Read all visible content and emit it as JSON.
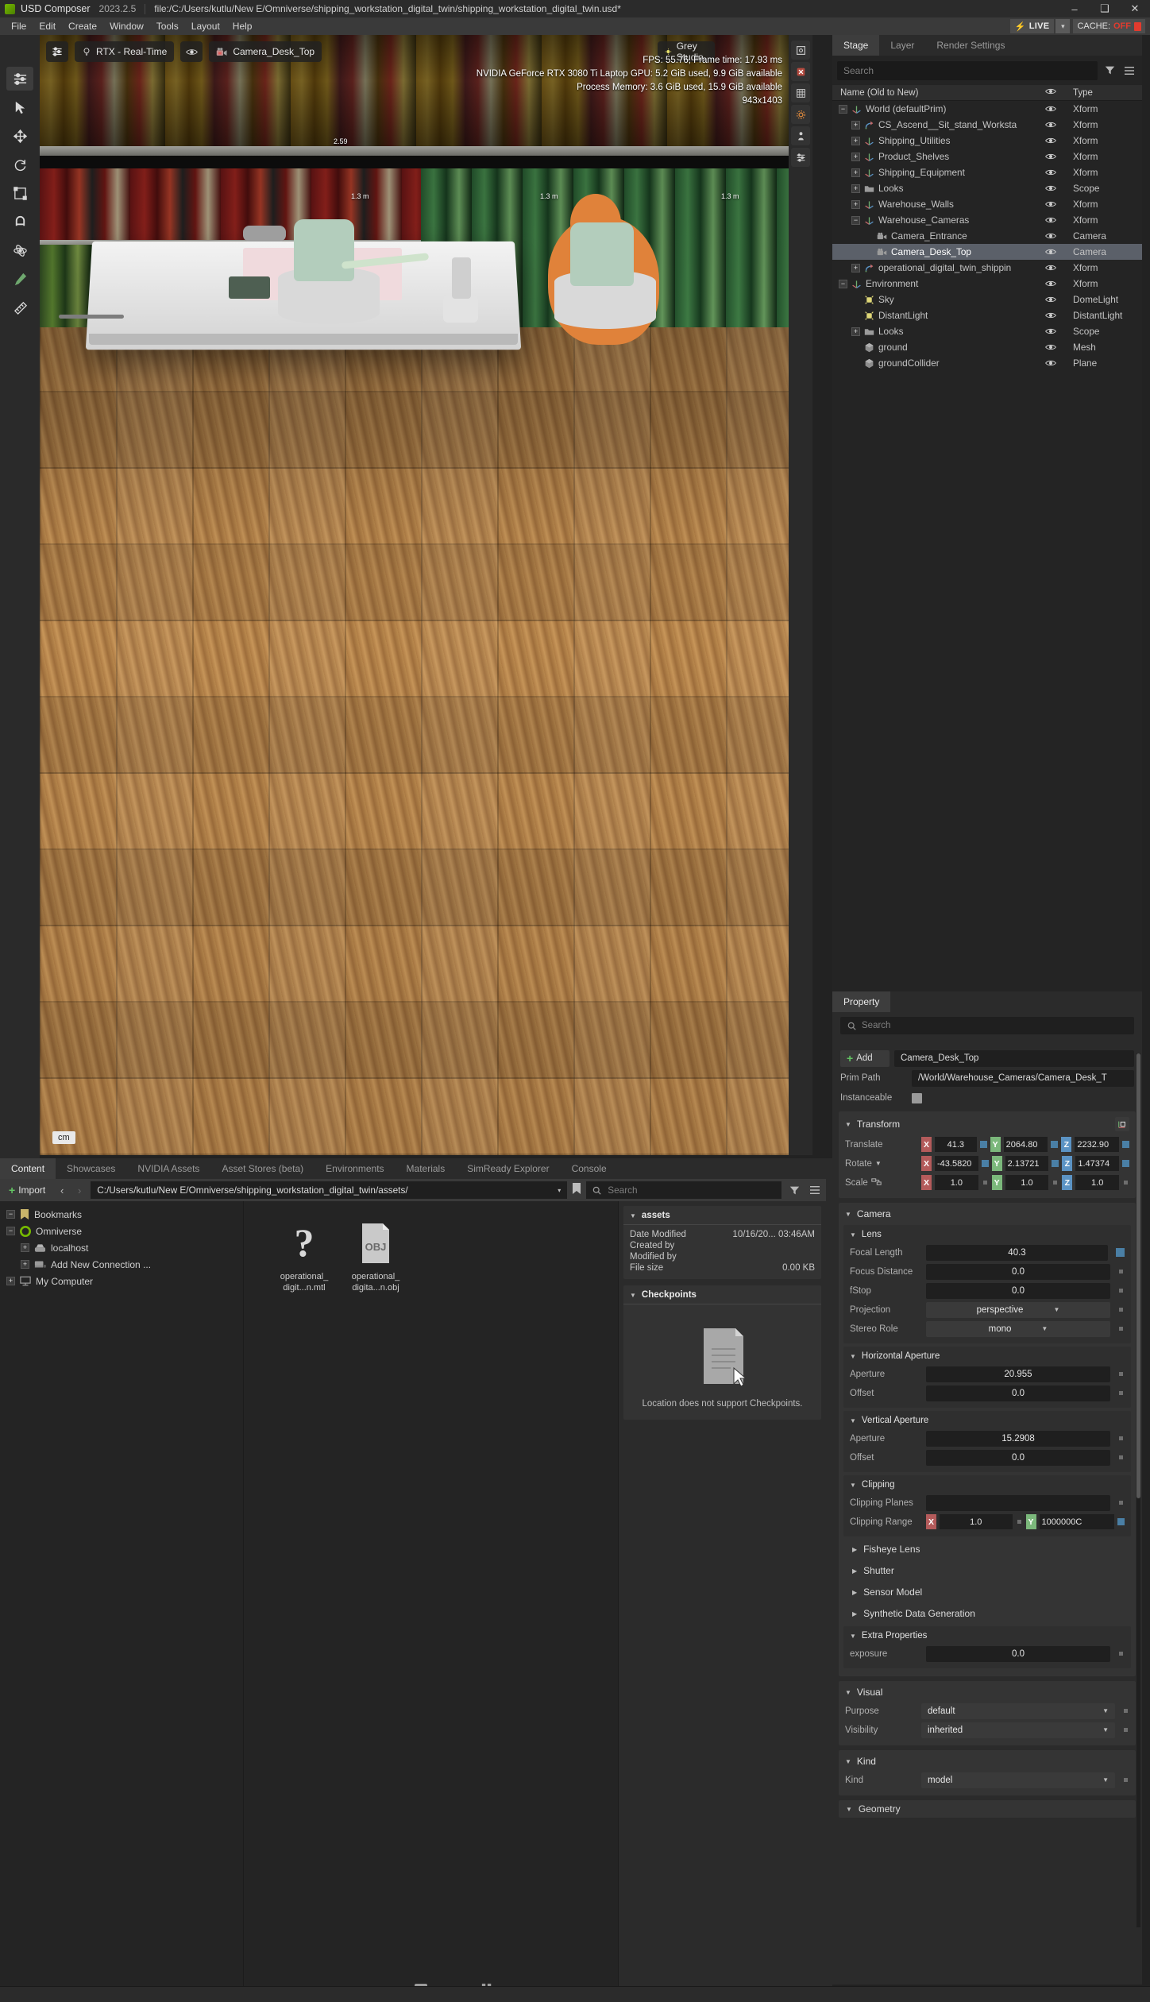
{
  "titlebar": {
    "app_name": "USD Composer",
    "version": "2023.2.5",
    "file_path": "file:/C:/Users/kutlu/New E/Omniverse/shipping_workstation_digital_twin/shipping_workstation_digital_twin.usd*",
    "minimize": "–",
    "maximize": "❑",
    "close": "✕"
  },
  "menubar": {
    "items": [
      "File",
      "Edit",
      "Create",
      "Window",
      "Tools",
      "Layout",
      "Help"
    ],
    "live_label": "LIVE",
    "live_bolt": "⚡",
    "live_caret": "▾",
    "cache_label": "CACHE:",
    "cache_value": "OFF"
  },
  "viewport": {
    "toolbar": {
      "settings_icon": "sliders-icon",
      "renderer": "RTX - Real-Time",
      "renderer_icon": "lightbulb-icon",
      "visibility_icon": "eye-icon",
      "camera_name": "Camera_Desk_Top",
      "camera_icon": "camera-lock-icon",
      "env_label": "Grey Studio",
      "env_icon": "sun-icon",
      "pin_icon": "pin-icon"
    },
    "stats": {
      "fps_line": "FPS: 55.76, Frame time: 17.93 ms",
      "gpu_line": "NVIDIA GeForce RTX 3080 Ti Laptop GPU: 5.2 GiB used, 9.9 GiB available",
      "memory_line": "Process Memory: 3.6 GiB used, 15.9 GiB available",
      "resolution_line": "943x1403"
    },
    "unit_badge": "cm",
    "measurements": [
      "2.59",
      "1.3 m",
      "1.3 m",
      "1.3 m"
    ]
  },
  "toolrail": {
    "items": [
      {
        "name": "tool-select-mode",
        "icon": "arrange-icon"
      },
      {
        "name": "tool-select",
        "icon": "cursor-icon"
      },
      {
        "name": "tool-move",
        "icon": "move-icon"
      },
      {
        "name": "tool-rotate",
        "icon": "rotate-icon"
      },
      {
        "name": "tool-scale",
        "icon": "scale-icon"
      },
      {
        "name": "tool-snap",
        "icon": "magnet-icon"
      },
      {
        "name": "tool-physics",
        "icon": "physics-icon"
      },
      {
        "name": "tool-paint",
        "icon": "brush-icon"
      },
      {
        "name": "tool-measure",
        "icon": "measure-icon"
      }
    ]
  },
  "stage": {
    "tabs": [
      {
        "label": "Stage",
        "active": true
      },
      {
        "label": "Layer",
        "active": false
      },
      {
        "label": "Render Settings",
        "active": false
      }
    ],
    "search_placeholder": "Search",
    "filter_icon": "filter-icon",
    "options_icon": "hamburger-icon",
    "columns": {
      "name": "Name (Old to New)",
      "visibility": "eye-icon",
      "type": "Type"
    },
    "rows": [
      {
        "label": "World (defaultPrim)",
        "type": "Xform",
        "depth": 0,
        "expander": "minus",
        "icon": "axis-icon",
        "selected": false
      },
      {
        "label": "CS_Ascend__Sit_stand_Worksta",
        "type": "Xform",
        "depth": 1,
        "expander": "plus",
        "icon": "payload-icon",
        "selected": false
      },
      {
        "label": "Shipping_Utilities",
        "type": "Xform",
        "depth": 1,
        "expander": "plus",
        "icon": "axis-icon",
        "selected": false
      },
      {
        "label": "Product_Shelves",
        "type": "Xform",
        "depth": 1,
        "expander": "plus",
        "icon": "axis-icon",
        "selected": false
      },
      {
        "label": "Shipping_Equipment",
        "type": "Xform",
        "depth": 1,
        "expander": "plus",
        "icon": "axis-icon",
        "selected": false
      },
      {
        "label": "Looks",
        "type": "Scope",
        "depth": 1,
        "expander": "plus",
        "icon": "folder-icon",
        "selected": false
      },
      {
        "label": "Warehouse_Walls",
        "type": "Xform",
        "depth": 1,
        "expander": "plus",
        "icon": "axis-icon",
        "selected": false
      },
      {
        "label": "Warehouse_Cameras",
        "type": "Xform",
        "depth": 1,
        "expander": "minus",
        "icon": "axis-icon",
        "selected": false
      },
      {
        "label": "Camera_Entrance",
        "type": "Camera",
        "depth": 2,
        "expander": "none",
        "icon": "camera-icon",
        "selected": false
      },
      {
        "label": "Camera_Desk_Top",
        "type": "Camera",
        "depth": 2,
        "expander": "none",
        "icon": "camera-icon",
        "selected": true
      },
      {
        "label": "operational_digital_twin_shippin",
        "type": "Xform",
        "depth": 1,
        "expander": "plus",
        "icon": "payload-icon",
        "selected": false
      },
      {
        "label": "Environment",
        "type": "Xform",
        "depth": 0,
        "expander": "minus",
        "icon": "axis-icon",
        "selected": false
      },
      {
        "label": "Sky",
        "type": "DomeLight",
        "depth": 1,
        "expander": "none",
        "icon": "light-icon",
        "selected": false
      },
      {
        "label": "DistantLight",
        "type": "DistantLight",
        "depth": 1,
        "expander": "none",
        "icon": "light-icon",
        "selected": false
      },
      {
        "label": "Looks",
        "type": "Scope",
        "depth": 1,
        "expander": "plus",
        "icon": "folder-icon",
        "selected": false
      },
      {
        "label": "ground",
        "type": "Mesh",
        "depth": 1,
        "expander": "none",
        "icon": "mesh-icon",
        "selected": false
      },
      {
        "label": "groundCollider",
        "type": "Plane",
        "depth": 1,
        "expander": "none",
        "icon": "mesh-icon",
        "selected": false
      }
    ]
  },
  "property": {
    "tab_label": "Property",
    "search_placeholder": "Search",
    "add_label": "Add",
    "prim_name": "Camera_Desk_Top",
    "prim_path_label": "Prim Path",
    "prim_path_value": "/World/Warehouse_Cameras/Camera_Desk_T",
    "instanceable_label": "Instanceable",
    "transform": {
      "title": "Transform",
      "translate_label": "Translate",
      "translate": {
        "x": "41.3",
        "y": "2064.80",
        "z": "2232.90"
      },
      "rotate_label": "Rotate",
      "rotate": {
        "x": "-43.5820",
        "y": "2.13721",
        "z": "1.47374"
      },
      "scale_label": "Scale",
      "scale": {
        "x": "1.0",
        "y": "1.0",
        "z": "1.0"
      }
    },
    "camera": {
      "title": "Camera",
      "lens": {
        "title": "Lens",
        "focal_length_label": "Focal Length",
        "focal_length": "40.3",
        "focus_distance_label": "Focus Distance",
        "focus_distance": "0.0",
        "fstop_label": "fStop",
        "fstop": "0.0",
        "projection_label": "Projection",
        "projection": "perspective",
        "stereo_role_label": "Stereo Role",
        "stereo_role": "mono"
      },
      "horizontal_aperture": {
        "title": "Horizontal Aperture",
        "aperture_label": "Aperture",
        "aperture": "20.955",
        "offset_label": "Offset",
        "offset": "0.0"
      },
      "vertical_aperture": {
        "title": "Vertical Aperture",
        "aperture_label": "Aperture",
        "aperture": "15.2908",
        "offset_label": "Offset",
        "offset": "0.0"
      },
      "clipping": {
        "title": "Clipping",
        "planes_label": "Clipping Planes",
        "planes_value": "",
        "range_label": "Clipping Range",
        "range": {
          "x": "1.0",
          "y": "1000000C"
        }
      },
      "collapsed_sections": [
        "Fisheye Lens",
        "Shutter",
        "Sensor Model",
        "Synthetic Data Generation"
      ],
      "extra": {
        "title": "Extra Properties",
        "exposure_label": "exposure",
        "exposure": "0.0"
      }
    },
    "visual": {
      "title": "Visual",
      "purpose_label": "Purpose",
      "purpose": "default",
      "visibility_label": "Visibility",
      "visibility": "inherited"
    },
    "kind": {
      "title": "Kind",
      "kind_label": "Kind",
      "kind": "model"
    },
    "geometry_title": "Geometry"
  },
  "content": {
    "tabs": [
      {
        "label": "Content",
        "active": true
      },
      {
        "label": "Showcases",
        "active": false
      },
      {
        "label": "NVIDIA Assets",
        "active": false
      },
      {
        "label": "Asset Stores (beta)",
        "active": false
      },
      {
        "label": "Environments",
        "active": false
      },
      {
        "label": "Materials",
        "active": false
      },
      {
        "label": "SimReady Explorer",
        "active": false
      },
      {
        "label": "Console",
        "active": false
      }
    ],
    "import_label": "Import",
    "back_arrow": "‹",
    "forward_arrow": "›",
    "path": "C:/Users/kutlu/New E/Omniverse/shipping_workstation_digital_twin/assets/",
    "path_caret": "▾",
    "bookmark_icon": "bookmark-icon",
    "search_placeholder": "Search",
    "filter_icon": "filter-icon",
    "options_icon": "hamburger-icon",
    "tree": [
      {
        "label": "Bookmarks",
        "depth": 0,
        "expander": "minus",
        "icon": "bookmark-icon"
      },
      {
        "label": "Omniverse",
        "depth": 0,
        "expander": "minus",
        "icon": "omniverse-icon"
      },
      {
        "label": "localhost",
        "depth": 1,
        "expander": "plus",
        "icon": "server-icon"
      },
      {
        "label": "Add New Connection ...",
        "depth": 1,
        "expander": "plus",
        "icon": "add-connection-icon"
      },
      {
        "label": "My Computer",
        "depth": 0,
        "expander": "plus",
        "icon": "computer-icon"
      }
    ],
    "assets": [
      {
        "name": "operational_\ndigit...n.mtl",
        "icon": "question-mark-icon"
      },
      {
        "name": "operational_\ndigita...n.obj",
        "icon": "obj-file-icon"
      }
    ],
    "details": {
      "title": "assets",
      "rows": [
        {
          "label": "Date Modified",
          "value": "10/16/20... 03:46AM"
        },
        {
          "label": "Created by",
          "value": ""
        },
        {
          "label": "Modified by",
          "value": ""
        },
        {
          "label": "File size",
          "value": "0.00 KB"
        }
      ],
      "checkpoints_title": "Checkpoints",
      "checkpoints_message": "Location does not support Checkpoints."
    }
  },
  "colors": {
    "accent_green": "#76b900",
    "axis_x": "#b45b5b",
    "axis_y": "#7bb87b",
    "axis_z": "#5b93c4",
    "selection": "#5b6069",
    "cache_off": "#e23b2e"
  }
}
